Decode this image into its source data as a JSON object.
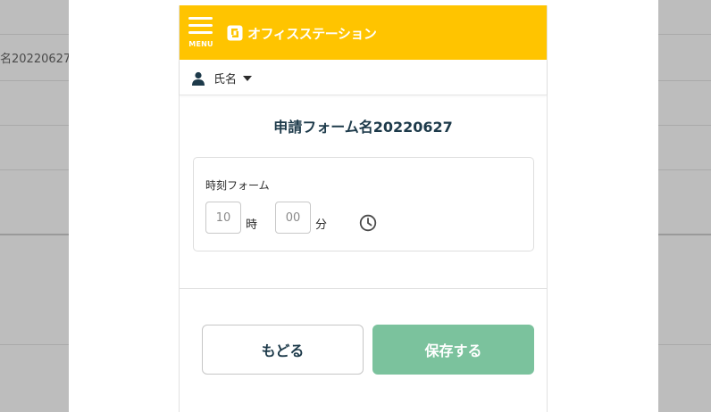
{
  "background": {
    "text_fragment": "名20220627"
  },
  "appbar": {
    "menu_label": "MENU",
    "logo_text": "オフィスステーション",
    "color": "#ffc400"
  },
  "user": {
    "name": "氏名"
  },
  "form": {
    "title": "申請フォーム名20220627",
    "field": {
      "label": "時刻フォーム",
      "hour_placeholder": "10",
      "hour_unit": "時",
      "minute_placeholder": "00",
      "minute_unit": "分"
    }
  },
  "actions": {
    "back_label": "もどる",
    "save_label": "保存する",
    "save_color": "#7bc29d"
  },
  "icons": {
    "menu": "hamburger-menu-icon",
    "logo": "office-station-logo-icon",
    "user": "user-icon",
    "caret": "caret-down-icon",
    "clock": "clock-icon"
  }
}
